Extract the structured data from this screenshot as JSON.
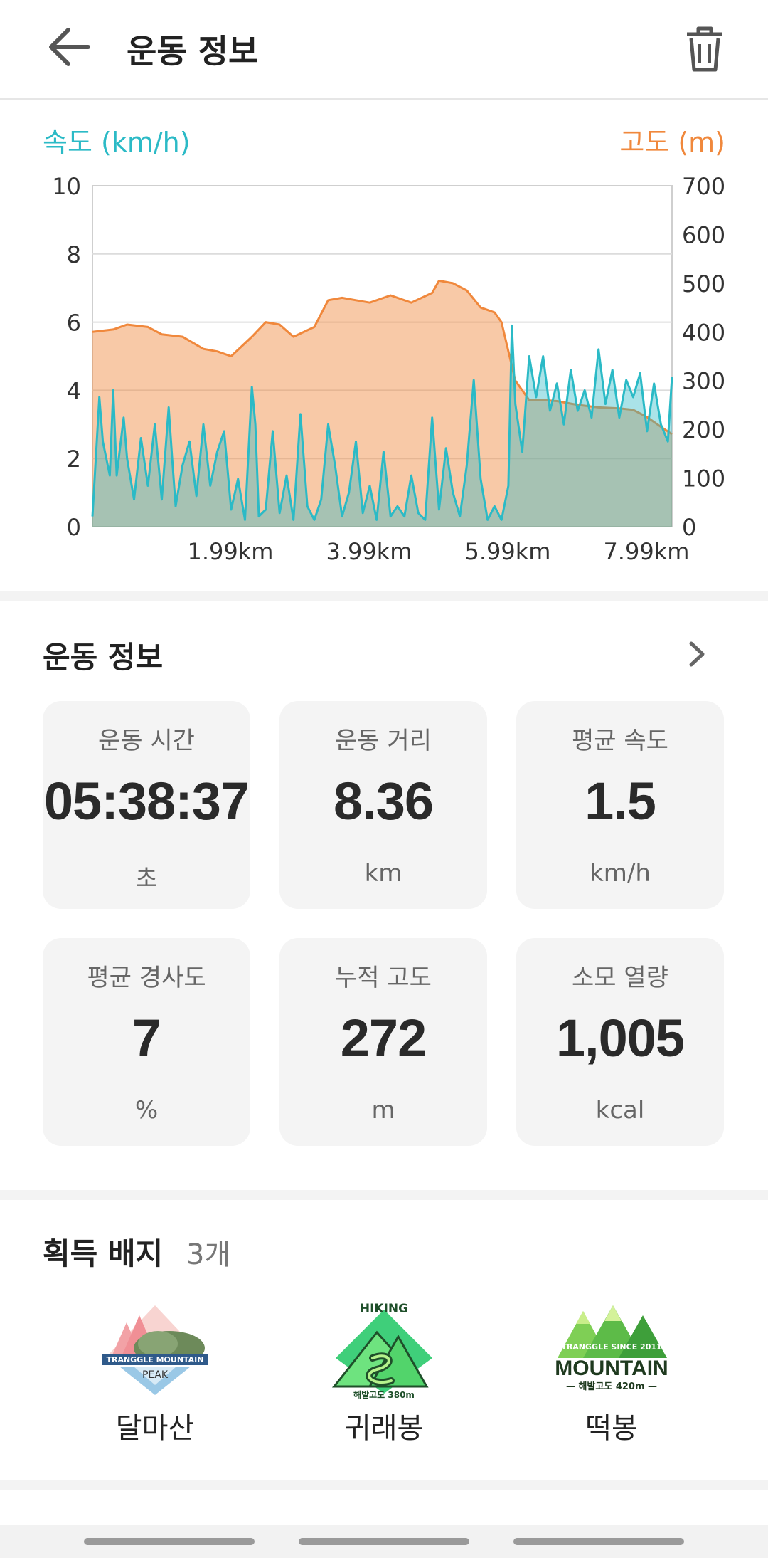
{
  "header": {
    "title": "운동 정보",
    "back_icon": "arrow-left-icon",
    "trash_icon": "trash-icon"
  },
  "chart": {
    "left_axis_label": "속도 (km/h)",
    "right_axis_label": "고도 (m)"
  },
  "chart_data": {
    "type": "area",
    "xlabel": "",
    "x_tick_labels": [
      "1.99km",
      "3.99km",
      "5.99km",
      "7.99km"
    ],
    "x_ticks": [
      1.99,
      3.99,
      5.99,
      7.99
    ],
    "xlim": [
      0,
      8.36
    ],
    "y_left": {
      "label": "속도 (km/h)",
      "lim": [
        0,
        10
      ],
      "ticks": [
        "0",
        "2",
        "4",
        "6",
        "8",
        "10"
      ],
      "color": "#2bbac6"
    },
    "y_right": {
      "label": "고도 (m)",
      "lim": [
        0,
        700
      ],
      "ticks": [
        "0",
        "100",
        "200",
        "300",
        "400",
        "500",
        "600",
        "700"
      ],
      "color": "#f0883c"
    },
    "grid": true,
    "series": [
      {
        "name": "고도 (m)",
        "axis": "right",
        "x": [
          0,
          0.3,
          0.5,
          0.8,
          1.0,
          1.3,
          1.6,
          1.8,
          2.0,
          2.3,
          2.5,
          2.7,
          2.9,
          3.2,
          3.4,
          3.6,
          3.8,
          4.0,
          4.3,
          4.6,
          4.9,
          5.0,
          5.2,
          5.4,
          5.6,
          5.8,
          5.9,
          6.1,
          6.3,
          6.5,
          6.7,
          7.0,
          7.3,
          7.6,
          7.8,
          8.0,
          8.2,
          8.36
        ],
        "values": [
          400,
          405,
          415,
          410,
          395,
          390,
          365,
          360,
          350,
          390,
          420,
          415,
          390,
          410,
          465,
          470,
          465,
          460,
          475,
          460,
          480,
          505,
          500,
          485,
          450,
          440,
          420,
          300,
          260,
          260,
          258,
          250,
          245,
          243,
          240,
          225,
          205,
          190
        ],
        "color": "#f0883c"
      },
      {
        "name": "속도 (km/h)",
        "axis": "left",
        "x": [
          0,
          0.1,
          0.15,
          0.25,
          0.3,
          0.35,
          0.45,
          0.5,
          0.6,
          0.7,
          0.8,
          0.9,
          1.0,
          1.1,
          1.15,
          1.2,
          1.3,
          1.4,
          1.5,
          1.6,
          1.7,
          1.8,
          1.9,
          2.0,
          2.1,
          2.2,
          2.3,
          2.35,
          2.4,
          2.5,
          2.6,
          2.7,
          2.8,
          2.9,
          3.0,
          3.1,
          3.2,
          3.3,
          3.4,
          3.5,
          3.6,
          3.7,
          3.8,
          3.9,
          4.0,
          4.1,
          4.2,
          4.3,
          4.4,
          4.5,
          4.6,
          4.7,
          4.8,
          4.9,
          5.0,
          5.1,
          5.2,
          5.3,
          5.4,
          5.5,
          5.6,
          5.7,
          5.8,
          5.9,
          6.0,
          6.05,
          6.1,
          6.2,
          6.3,
          6.4,
          6.5,
          6.6,
          6.7,
          6.8,
          6.9,
          7.0,
          7.1,
          7.2,
          7.3,
          7.4,
          7.5,
          7.6,
          7.7,
          7.8,
          7.9,
          8.0,
          8.1,
          8.2,
          8.3,
          8.36
        ],
        "values": [
          0.3,
          3.8,
          2.5,
          1.5,
          4.0,
          1.5,
          3.2,
          2.0,
          0.8,
          2.6,
          1.2,
          3.0,
          0.8,
          3.5,
          2.0,
          0.6,
          1.8,
          2.5,
          0.9,
          3.0,
          1.2,
          2.2,
          2.8,
          0.5,
          1.4,
          0.2,
          4.1,
          3.0,
          0.3,
          0.5,
          2.8,
          0.4,
          1.5,
          0.2,
          3.3,
          0.6,
          0.2,
          0.8,
          3.0,
          1.8,
          0.3,
          1.0,
          2.5,
          0.4,
          1.2,
          0.2,
          2.2,
          0.3,
          0.6,
          0.3,
          1.5,
          0.4,
          0.2,
          3.2,
          0.5,
          2.3,
          1.0,
          0.3,
          1.8,
          4.3,
          1.4,
          0.2,
          0.6,
          0.2,
          1.2,
          5.9,
          3.6,
          2.2,
          5.0,
          3.8,
          5.0,
          3.4,
          4.2,
          3.0,
          4.6,
          3.4,
          4.0,
          3.2,
          5.2,
          3.6,
          4.6,
          3.2,
          4.3,
          3.8,
          4.5,
          2.8,
          4.2,
          3.0,
          2.5,
          4.4
        ],
        "color": "#2bbac6"
      }
    ]
  },
  "stats": {
    "title": "운동 정보",
    "chevron_icon": "chevron-right-icon",
    "cards": [
      {
        "label": "운동 시간",
        "value": "05:38:37",
        "unit": "초"
      },
      {
        "label": "운동 거리",
        "value": "8.36",
        "unit": "km"
      },
      {
        "label": "평균 속도",
        "value": "1.5",
        "unit": "km/h"
      },
      {
        "label": "평균 경사도",
        "value": "7",
        "unit": "%"
      },
      {
        "label": "누적 고도",
        "value": "272",
        "unit": "m"
      },
      {
        "label": "소모 열량",
        "value": "1,005",
        "unit": "kcal"
      }
    ]
  },
  "badges": {
    "title": "획득 배지",
    "count": "3개",
    "items": [
      {
        "name": "달마산",
        "art_text": "TRANGGLE MOUNTAIN PEAK"
      },
      {
        "name": "귀래봉",
        "art_text": "HIKING 해발고도 380m"
      },
      {
        "name": "떡봉",
        "art_text": "TRANGGLE SINCE 2011 MOUNTAIN 해발고도 420m"
      }
    ]
  }
}
